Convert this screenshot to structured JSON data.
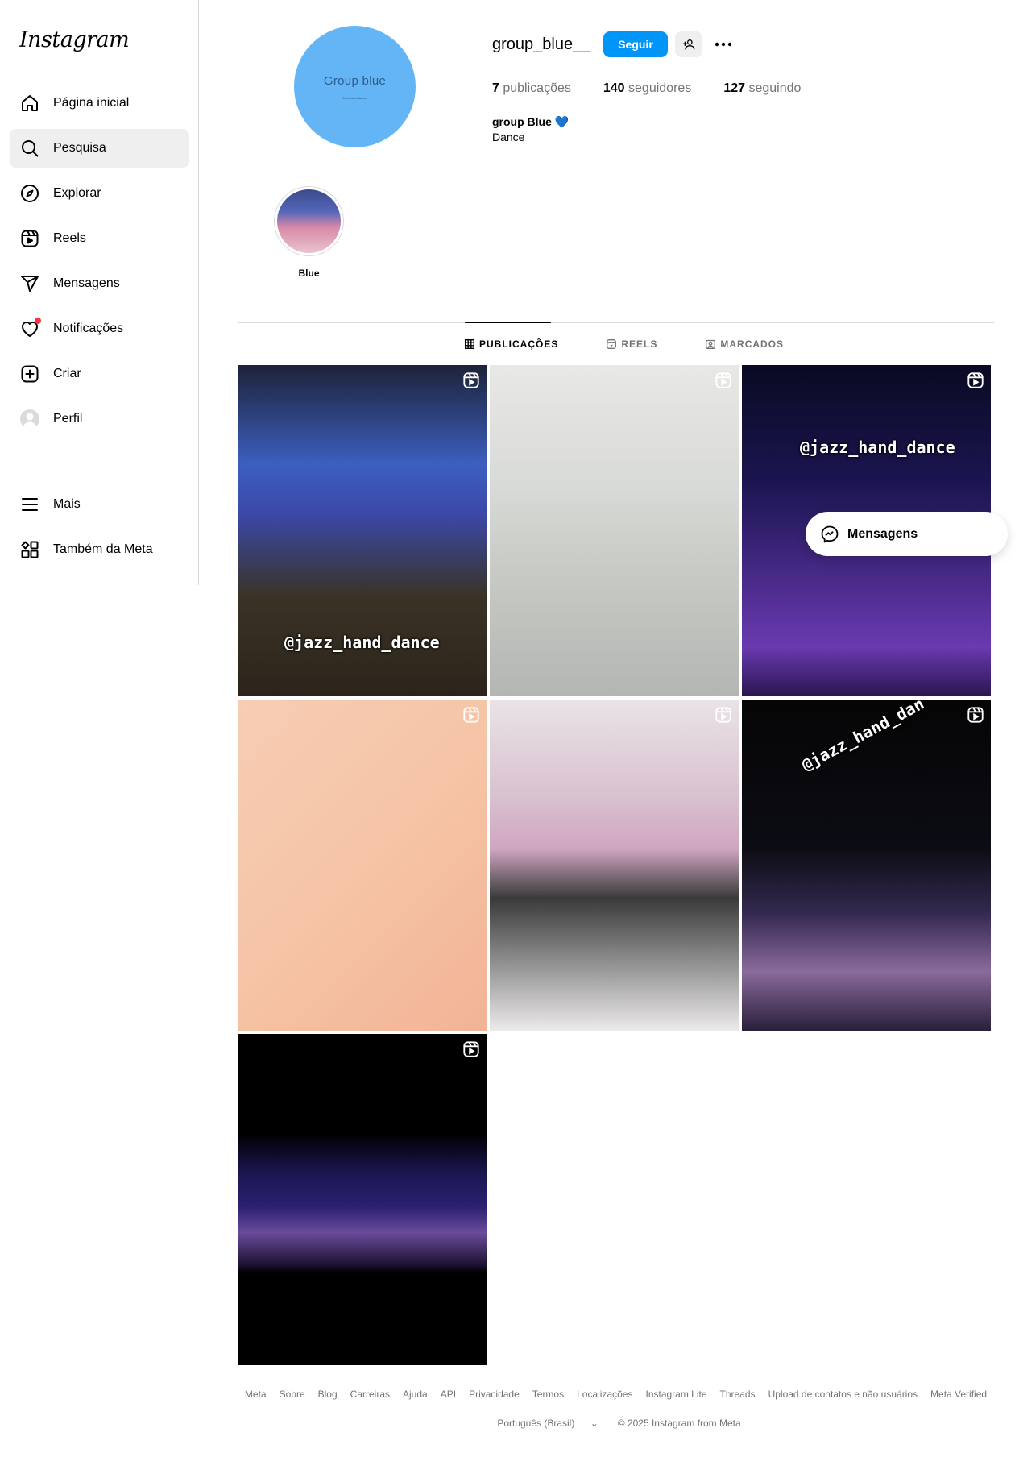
{
  "app": {
    "logo_text": "Instagram"
  },
  "sidebar": {
    "items": [
      {
        "label": "Página inicial",
        "icon": "home-icon"
      },
      {
        "label": "Pesquisa",
        "icon": "search-icon"
      },
      {
        "label": "Explorar",
        "icon": "compass-icon"
      },
      {
        "label": "Reels",
        "icon": "reels-icon"
      },
      {
        "label": "Mensagens",
        "icon": "messenger-icon"
      },
      {
        "label": "Notificações",
        "icon": "heart-icon"
      },
      {
        "label": "Criar",
        "icon": "plus-square-icon"
      },
      {
        "label": "Perfil",
        "icon": "avatar"
      }
    ],
    "bottom_items": [
      {
        "label": "Mais",
        "icon": "menu-icon"
      },
      {
        "label": "Também da Meta",
        "icon": "meta-apps-icon"
      }
    ]
  },
  "profile": {
    "picture_title": "Group blue",
    "picture_subtitle": "Jazz hand dance",
    "username": "group_blue__",
    "follow_label": "Seguir",
    "stats": {
      "posts_count": "7",
      "posts_label": "publicações",
      "followers_count": "140",
      "followers_label": "seguidores",
      "following_count": "127",
      "following_label": "seguindo"
    },
    "bio_name": "group Blue 💙",
    "bio_text": "Dance"
  },
  "highlights": [
    {
      "label": "Blue"
    }
  ],
  "tabs": [
    {
      "label": "PUBLICAÇÕES",
      "active": true,
      "icon": "grid-icon"
    },
    {
      "label": "REELS",
      "active": false,
      "icon": "reels-tab-icon"
    },
    {
      "label": "MARCADOS",
      "active": false,
      "icon": "tagged-icon"
    }
  ],
  "posts": [
    {
      "overlay_text": "@jazz_hand_dance",
      "type": "reel"
    },
    {
      "overlay_text": "",
      "type": "reel"
    },
    {
      "overlay_text": "@jazz_hand_dance",
      "type": "reel"
    },
    {
      "overlay_text": "",
      "type": "reel"
    },
    {
      "overlay_text": "",
      "type": "reel"
    },
    {
      "overlay_text": "@jazz_hand_dan",
      "type": "reel"
    },
    {
      "overlay_text": "",
      "type": "reel"
    }
  ],
  "floating_messages": {
    "label": "Mensagens"
  },
  "footer": {
    "links": [
      "Meta",
      "Sobre",
      "Blog",
      "Carreiras",
      "Ajuda",
      "API",
      "Privacidade",
      "Termos",
      "Localizações",
      "Instagram Lite",
      "Threads",
      "Upload de contatos e não usuários",
      "Meta Verified"
    ],
    "language": "Português (Brasil)",
    "copyright": "© 2025 Instagram from Meta"
  },
  "colors": {
    "accent": "#0095f6",
    "notification_dot": "#ff3040",
    "profile_picture_bg": "#64b5f6"
  }
}
